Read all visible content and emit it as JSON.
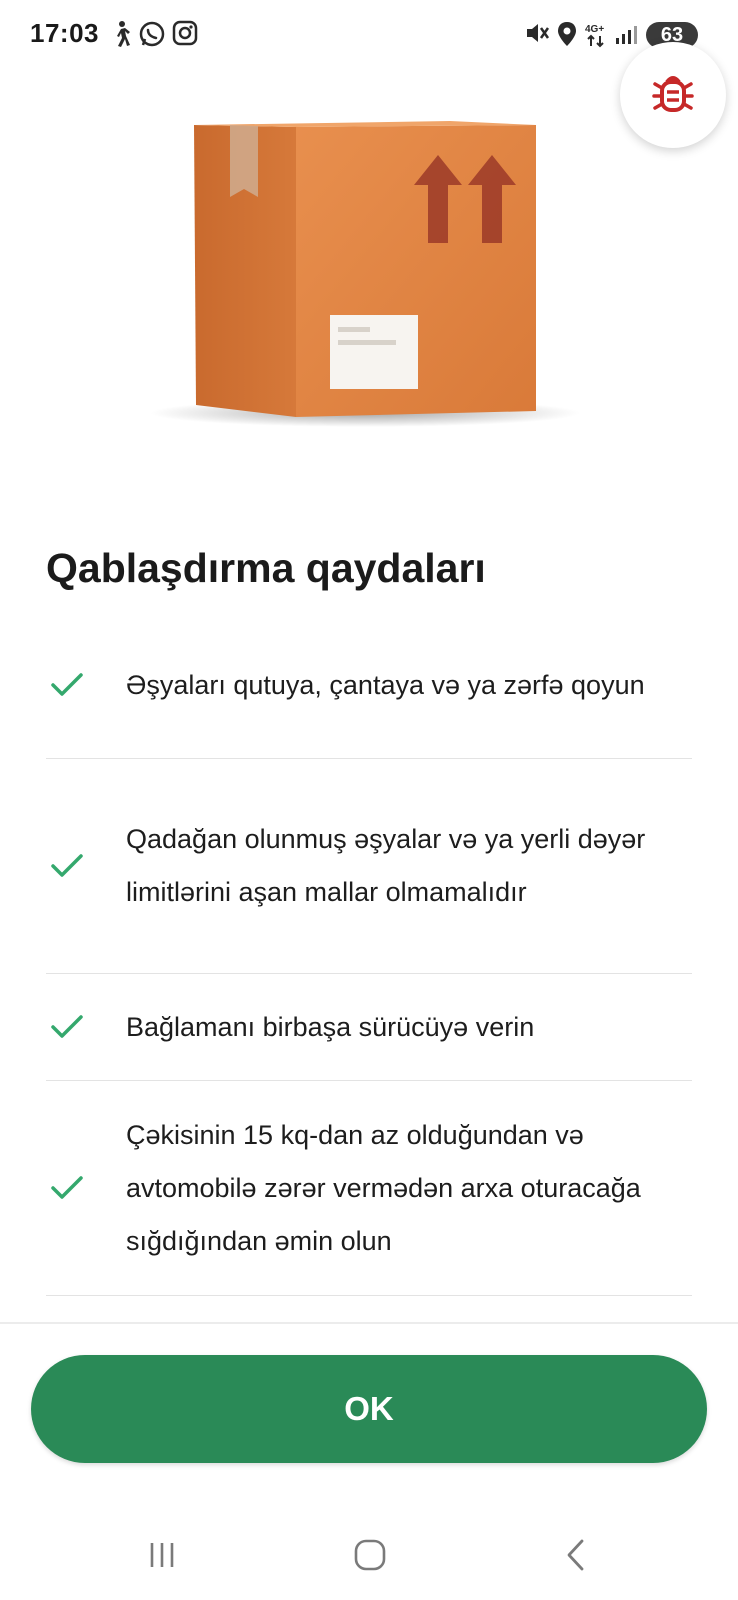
{
  "status_bar": {
    "time": "17:03",
    "left_icons": [
      "walking-icon",
      "whatsapp-icon",
      "instagram-icon"
    ],
    "right_icons": [
      "mute-icon",
      "location-icon",
      "network-4g-icon",
      "signal-icon"
    ],
    "network_label": "4G+",
    "battery": "63"
  },
  "bug_button": {
    "icon": "bug-icon",
    "color": "#c62828"
  },
  "hero": {
    "icon": "cardboard-box-illustration"
  },
  "title": "Qablaşdırma qaydaları",
  "rules": [
    {
      "text": "Əşyaları qutuya, çantaya və ya zərfə qoyun"
    },
    {
      "text": "Qadağan olunmuş əşyalar və ya yerli dəyər limitlərini aşan mallar olmamalıdır"
    },
    {
      "text": "Bağlamanı birbaşa sürücüyə verin"
    },
    {
      "text": "Çəkisinin 15 kq-dan az olduğundan və avtomobilə zərər vermədən arxa oturacağa sığdığından əmin olun"
    }
  ],
  "ok_button": {
    "label": "OK",
    "color": "#2a8a57"
  },
  "check_color": "#34a86d",
  "nav_bar": {
    "icons": [
      "recent-apps-icon",
      "home-icon",
      "back-icon"
    ]
  }
}
